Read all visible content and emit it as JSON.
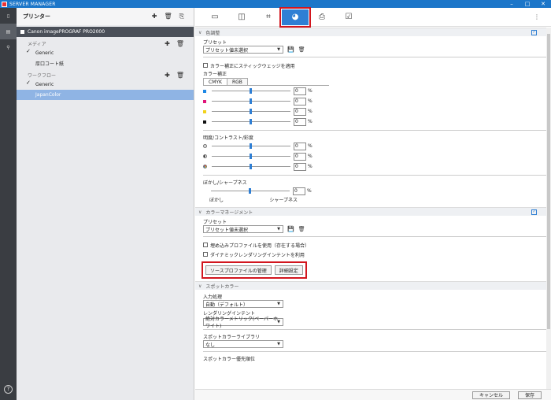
{
  "window": {
    "title": "SERVER MANAGER"
  },
  "left_panel": {
    "title": "プリンター",
    "printer": "Canon imagePROGRAF PRO2000",
    "media": {
      "label": "メディア",
      "items": [
        {
          "label": "Generic",
          "checked": true
        },
        {
          "label": "厚口コート紙",
          "checked": false
        }
      ]
    },
    "workflow": {
      "label": "ワークフロー",
      "items": [
        {
          "label": "Generic",
          "checked": true
        },
        {
          "label": "JapanColor",
          "checked": false,
          "selected": true
        }
      ]
    }
  },
  "color_adjust": {
    "header": "色調整",
    "preset_label": "プリセット",
    "preset_value": "プリセット値未選択",
    "wedge_label": "カラー補正にスティックウェッジを適用",
    "correction_label": "カラー補正",
    "tabs": [
      "CMYK",
      "RGB"
    ],
    "cmyk": [
      {
        "value": "0",
        "color": "#1e88e5"
      },
      {
        "value": "0",
        "color": "#e0157a"
      },
      {
        "value": "0",
        "color": "#f2d21b"
      },
      {
        "value": "0",
        "color": "#111111"
      }
    ],
    "bcs_label": "明度/コントラスト/彩度",
    "bcs": [
      {
        "value": "0"
      },
      {
        "value": "0"
      },
      {
        "value": "0"
      }
    ],
    "blur_label": "ぼかし/シャープネス",
    "blur_value": "0",
    "blur_left": "ぼかし",
    "blur_right": "シャープネス",
    "pct": "%"
  },
  "color_mgmt": {
    "header": "カラーマネージメント",
    "preset_label": "プリセット",
    "preset_value": "プリセット値未選択",
    "embedded_label": "埋め込みプロファイルを使用（存在する場合）",
    "dynamic_label": "ダイナミックレンダリングインテントを利用",
    "source_btn": "ソースプロファイルの管理",
    "detail_btn": "詳細設定"
  },
  "spot_color": {
    "header": "スポットカラー",
    "input_label": "入力処理",
    "input_value": "自動（デフォルト）",
    "intent_label": "レンダリングインテント",
    "intent_value": "絶対カラーメトリック(ペーパーホワイト)",
    "library_label": "スポットカラーライブラリ",
    "library_value": "なし",
    "priority_label": "スポットカラー優先順位"
  },
  "footer": {
    "cancel": "キャンセル",
    "save": "保存"
  }
}
